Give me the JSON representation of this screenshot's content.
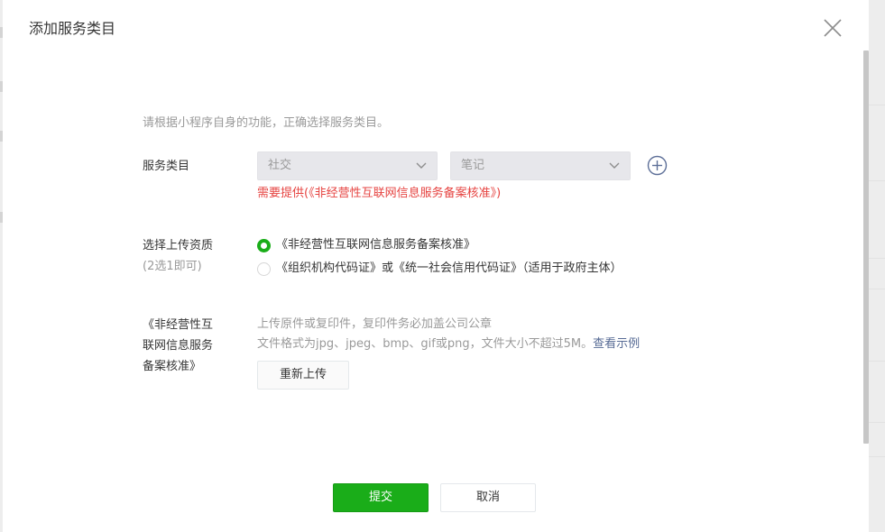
{
  "dialog": {
    "title": "添加服务类目"
  },
  "intro": "请根据小程序自身的功能，正确选择服务类目。",
  "service_category": {
    "label": "服务类目",
    "primary_select": "社交",
    "secondary_select": "笔记",
    "requirement_notice": "需要提供(《非经营性互联网信息服务备案核准》)"
  },
  "qualification": {
    "label": "选择上传资质",
    "sublabel": "(2选1即可)",
    "options": [
      {
        "label": "《非经营性互联网信息服务备案核准》",
        "checked": true
      },
      {
        "label": "《组织机构代码证》或《统一社会信用代码证》（适用于政府主体）",
        "checked": false
      }
    ]
  },
  "upload": {
    "label_line1": "《非经营性互",
    "label_line2": "联网信息服务",
    "label_line3": "备案核准》",
    "hint_line1": "上传原件或复印件，复印件务必加盖公司公章",
    "hint_line2": "文件格式为jpg、jpeg、bmp、gif或png，文件大小不超过5M。",
    "example_link": "查看示例",
    "reupload_label": "重新上传"
  },
  "footer": {
    "submit_label": "提交",
    "cancel_label": "取消"
  },
  "colors": {
    "primary": "#1aad19",
    "warning": "#e64340",
    "link": "#576b95",
    "muted": "#9a9a9a"
  },
  "icons": {
    "close": "close-icon",
    "add": "plus-circle-icon",
    "dropdown": "chevron-down-icon"
  }
}
